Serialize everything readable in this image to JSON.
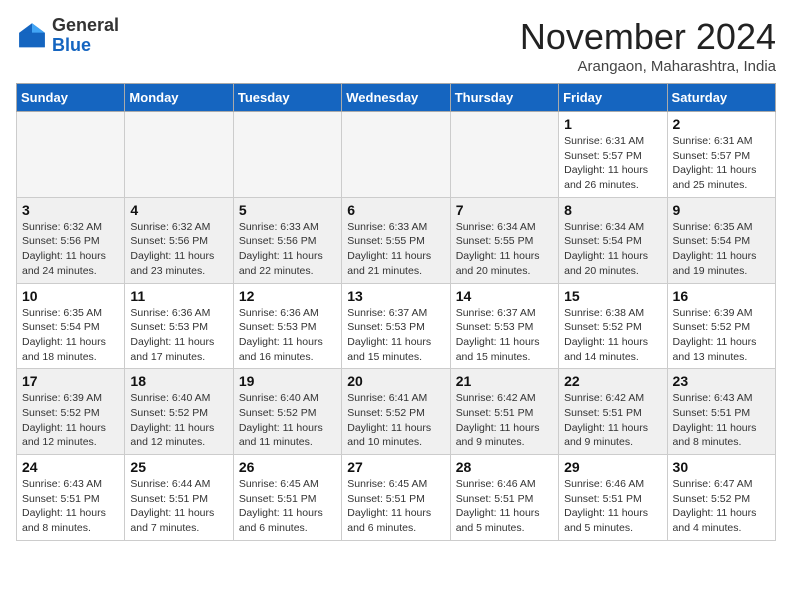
{
  "header": {
    "logo_general": "General",
    "logo_blue": "Blue",
    "month_title": "November 2024",
    "location": "Arangaon, Maharashtra, India"
  },
  "weekdays": [
    "Sunday",
    "Monday",
    "Tuesday",
    "Wednesday",
    "Thursday",
    "Friday",
    "Saturday"
  ],
  "weeks": [
    [
      {
        "day": "",
        "info": ""
      },
      {
        "day": "",
        "info": ""
      },
      {
        "day": "",
        "info": ""
      },
      {
        "day": "",
        "info": ""
      },
      {
        "day": "",
        "info": ""
      },
      {
        "day": "1",
        "info": "Sunrise: 6:31 AM\nSunset: 5:57 PM\nDaylight: 11 hours and 26 minutes."
      },
      {
        "day": "2",
        "info": "Sunrise: 6:31 AM\nSunset: 5:57 PM\nDaylight: 11 hours and 25 minutes."
      }
    ],
    [
      {
        "day": "3",
        "info": "Sunrise: 6:32 AM\nSunset: 5:56 PM\nDaylight: 11 hours and 24 minutes."
      },
      {
        "day": "4",
        "info": "Sunrise: 6:32 AM\nSunset: 5:56 PM\nDaylight: 11 hours and 23 minutes."
      },
      {
        "day": "5",
        "info": "Sunrise: 6:33 AM\nSunset: 5:56 PM\nDaylight: 11 hours and 22 minutes."
      },
      {
        "day": "6",
        "info": "Sunrise: 6:33 AM\nSunset: 5:55 PM\nDaylight: 11 hours and 21 minutes."
      },
      {
        "day": "7",
        "info": "Sunrise: 6:34 AM\nSunset: 5:55 PM\nDaylight: 11 hours and 20 minutes."
      },
      {
        "day": "8",
        "info": "Sunrise: 6:34 AM\nSunset: 5:54 PM\nDaylight: 11 hours and 20 minutes."
      },
      {
        "day": "9",
        "info": "Sunrise: 6:35 AM\nSunset: 5:54 PM\nDaylight: 11 hours and 19 minutes."
      }
    ],
    [
      {
        "day": "10",
        "info": "Sunrise: 6:35 AM\nSunset: 5:54 PM\nDaylight: 11 hours and 18 minutes."
      },
      {
        "day": "11",
        "info": "Sunrise: 6:36 AM\nSunset: 5:53 PM\nDaylight: 11 hours and 17 minutes."
      },
      {
        "day": "12",
        "info": "Sunrise: 6:36 AM\nSunset: 5:53 PM\nDaylight: 11 hours and 16 minutes."
      },
      {
        "day": "13",
        "info": "Sunrise: 6:37 AM\nSunset: 5:53 PM\nDaylight: 11 hours and 15 minutes."
      },
      {
        "day": "14",
        "info": "Sunrise: 6:37 AM\nSunset: 5:53 PM\nDaylight: 11 hours and 15 minutes."
      },
      {
        "day": "15",
        "info": "Sunrise: 6:38 AM\nSunset: 5:52 PM\nDaylight: 11 hours and 14 minutes."
      },
      {
        "day": "16",
        "info": "Sunrise: 6:39 AM\nSunset: 5:52 PM\nDaylight: 11 hours and 13 minutes."
      }
    ],
    [
      {
        "day": "17",
        "info": "Sunrise: 6:39 AM\nSunset: 5:52 PM\nDaylight: 11 hours and 12 minutes."
      },
      {
        "day": "18",
        "info": "Sunrise: 6:40 AM\nSunset: 5:52 PM\nDaylight: 11 hours and 12 minutes."
      },
      {
        "day": "19",
        "info": "Sunrise: 6:40 AM\nSunset: 5:52 PM\nDaylight: 11 hours and 11 minutes."
      },
      {
        "day": "20",
        "info": "Sunrise: 6:41 AM\nSunset: 5:52 PM\nDaylight: 11 hours and 10 minutes."
      },
      {
        "day": "21",
        "info": "Sunrise: 6:42 AM\nSunset: 5:51 PM\nDaylight: 11 hours and 9 minutes."
      },
      {
        "day": "22",
        "info": "Sunrise: 6:42 AM\nSunset: 5:51 PM\nDaylight: 11 hours and 9 minutes."
      },
      {
        "day": "23",
        "info": "Sunrise: 6:43 AM\nSunset: 5:51 PM\nDaylight: 11 hours and 8 minutes."
      }
    ],
    [
      {
        "day": "24",
        "info": "Sunrise: 6:43 AM\nSunset: 5:51 PM\nDaylight: 11 hours and 8 minutes."
      },
      {
        "day": "25",
        "info": "Sunrise: 6:44 AM\nSunset: 5:51 PM\nDaylight: 11 hours and 7 minutes."
      },
      {
        "day": "26",
        "info": "Sunrise: 6:45 AM\nSunset: 5:51 PM\nDaylight: 11 hours and 6 minutes."
      },
      {
        "day": "27",
        "info": "Sunrise: 6:45 AM\nSunset: 5:51 PM\nDaylight: 11 hours and 6 minutes."
      },
      {
        "day": "28",
        "info": "Sunrise: 6:46 AM\nSunset: 5:51 PM\nDaylight: 11 hours and 5 minutes."
      },
      {
        "day": "29",
        "info": "Sunrise: 6:46 AM\nSunset: 5:51 PM\nDaylight: 11 hours and 5 minutes."
      },
      {
        "day": "30",
        "info": "Sunrise: 6:47 AM\nSunset: 5:52 PM\nDaylight: 11 hours and 4 minutes."
      }
    ]
  ]
}
